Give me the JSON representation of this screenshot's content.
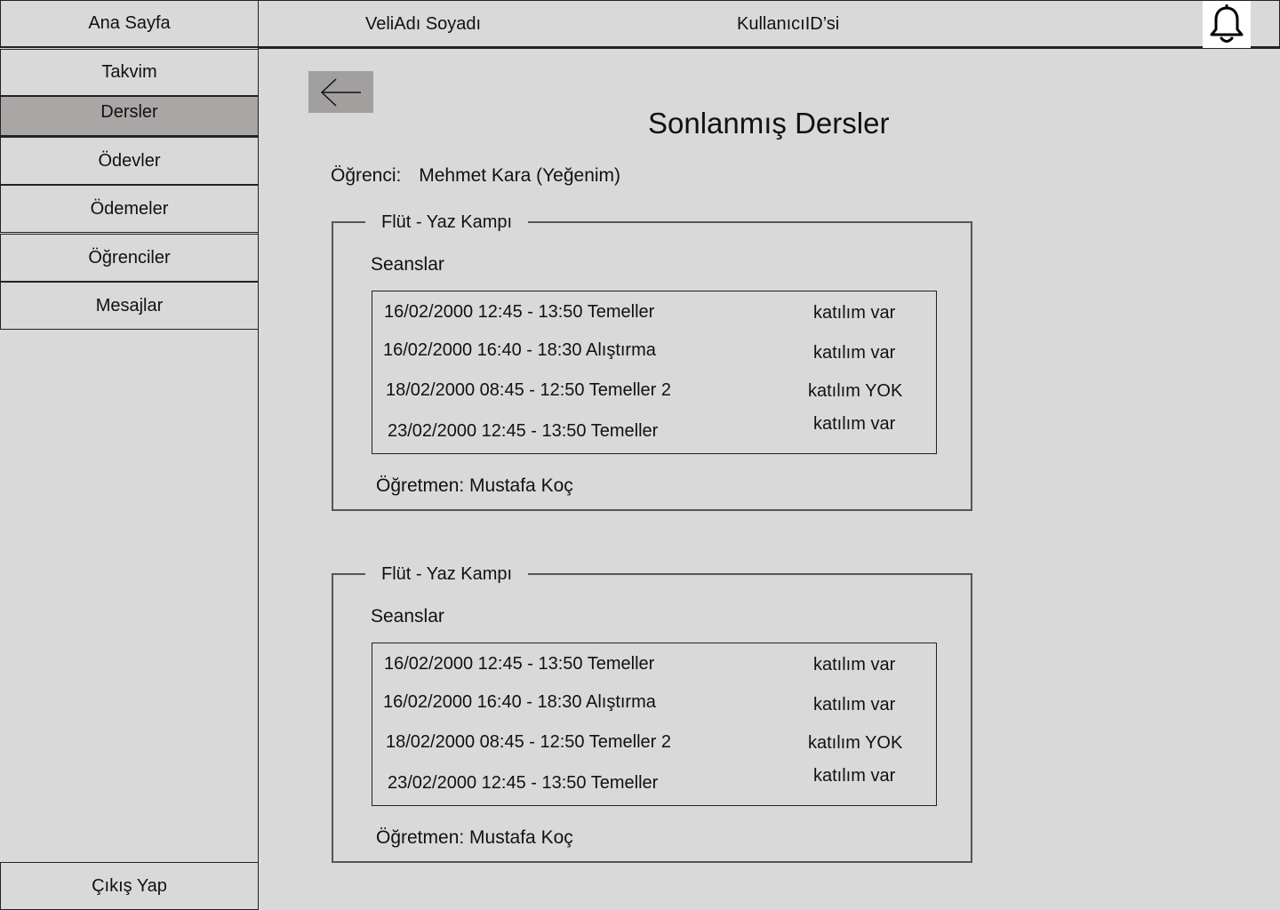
{
  "sidebar": {
    "home": "Ana Sayfa",
    "items": [
      {
        "label": "Takvim"
      },
      {
        "label": "Dersler"
      },
      {
        "label": "Ödevler"
      },
      {
        "label": "Ödemeler"
      },
      {
        "label": "Öğrenciler"
      },
      {
        "label": "Mesajlar"
      }
    ],
    "active_item": "Dersler",
    "logout": "Çıkış Yap"
  },
  "header": {
    "parent_name": "VeliAdı Soyadı",
    "user_id": "KullanıcıID’si",
    "notification_icon": "bell-icon"
  },
  "page": {
    "back_icon": "arrow-left-icon",
    "title": "Sonlanmış Dersler",
    "student_label": "Öğrenci:",
    "student_name": "Mehmet Kara (Yeğenim)"
  },
  "courses": [
    {
      "title": "Flüt - Yaz Kampı",
      "sessions_label": "Seanslar",
      "sessions": [
        {
          "text": "16/02/2000 12:45 - 13:50 Temeller",
          "status": "katılım var"
        },
        {
          "text": "16/02/2000 16:40 - 18:30 Alıştırma",
          "status": "katılım var"
        },
        {
          "text": "18/02/2000 08:45 - 12:50 Temeller 2",
          "status": "katılım YOK"
        },
        {
          "text": "23/02/2000 12:45 - 13:50 Temeller",
          "status": "katılım var"
        }
      ],
      "teacher": "Öğretmen: Mustafa Koç"
    },
    {
      "title": "Flüt - Yaz Kampı",
      "sessions_label": "Seanslar",
      "sessions": [
        {
          "text": "16/02/2000 12:45 - 13:50 Temeller",
          "status": "katılım var"
        },
        {
          "text": "16/02/2000 16:40 - 18:30 Alıştırma",
          "status": "katılım var"
        },
        {
          "text": "18/02/2000 08:45 - 12:50 Temeller 2",
          "status": "katılım YOK"
        },
        {
          "text": "23/02/2000 12:45 - 13:50 Temeller",
          "status": "katılım var"
        }
      ],
      "teacher": "Öğretmen: Mustafa Koç"
    }
  ]
}
